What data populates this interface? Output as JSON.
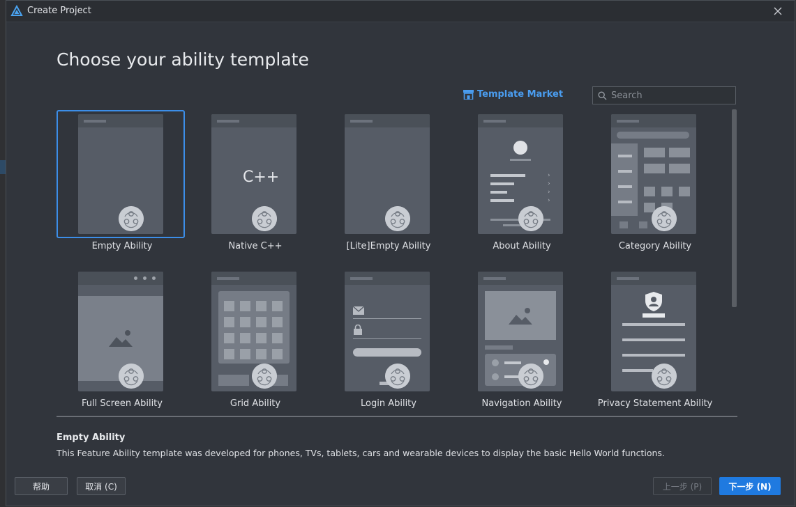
{
  "window": {
    "title": "Create Project"
  },
  "page": {
    "heading": "Choose your ability template"
  },
  "market": {
    "label": "Template Market"
  },
  "search": {
    "placeholder": "Search"
  },
  "templates": [
    {
      "label": "Empty Ability",
      "selected": true
    },
    {
      "label": "Native C++",
      "selected": false
    },
    {
      "label": "[Lite]Empty Ability",
      "selected": false
    },
    {
      "label": "About Ability",
      "selected": false
    },
    {
      "label": "Category Ability",
      "selected": false
    },
    {
      "label": "Full Screen Ability",
      "selected": false
    },
    {
      "label": "Grid Ability",
      "selected": false
    },
    {
      "label": "Login Ability",
      "selected": false
    },
    {
      "label": "Navigation Ability",
      "selected": false
    },
    {
      "label": "Privacy Statement Ability",
      "selected": false
    }
  ],
  "native_glyph": "C++",
  "description": {
    "title": "Empty Ability",
    "body": "This Feature Ability template was developed for phones, TVs, tablets, cars and wearable devices to display the basic Hello World functions."
  },
  "buttons": {
    "help": "帮助",
    "cancel": "取消 (C)",
    "previous": "上一步 (P)",
    "next": "下一步 (N)"
  },
  "colors": {
    "accent": "#1f7ae0",
    "selection": "#3c8ee8",
    "market": "#4a9df0"
  },
  "icons": {
    "logo": "deveco-logo-icon",
    "close": "close-icon",
    "search": "search-icon",
    "market": "store-icon",
    "badge": "harmony-badge-icon"
  }
}
